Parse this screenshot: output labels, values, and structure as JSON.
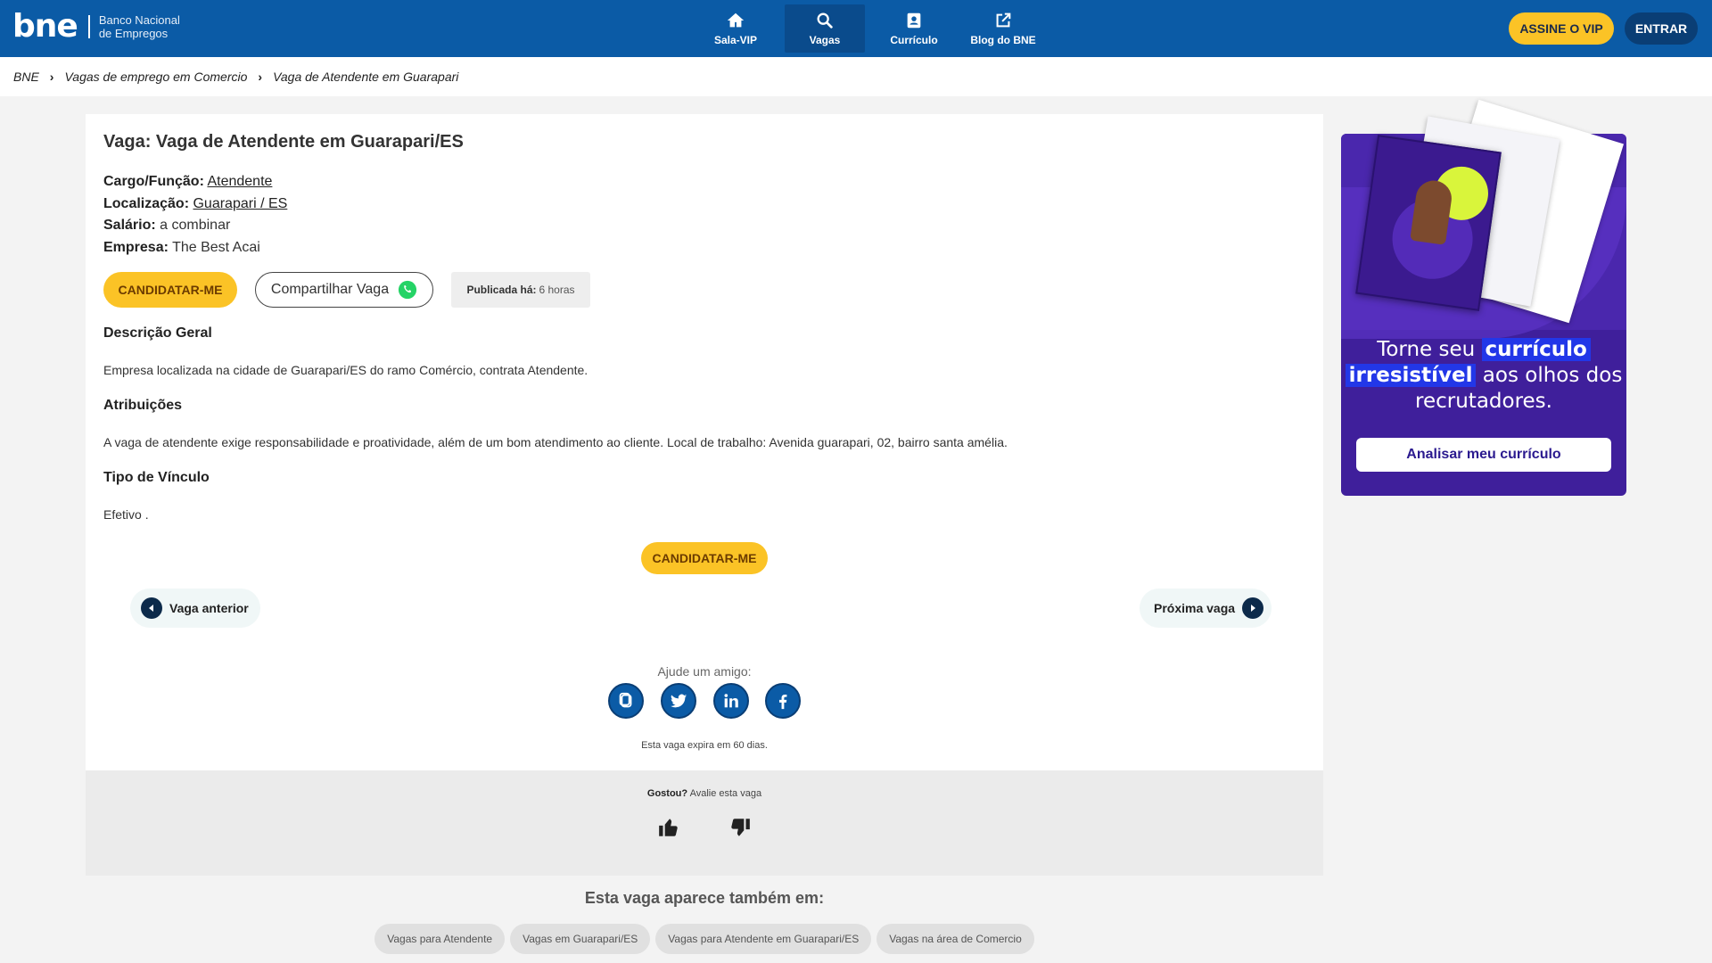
{
  "header": {
    "logo_mark": "bne",
    "logo_line1": "Banco Nacional",
    "logo_line2": "de Empregos",
    "nav": [
      {
        "label": "Sala-VIP",
        "icon": "home-icon"
      },
      {
        "label": "Vagas",
        "icon": "search-icon"
      },
      {
        "label": "Currículo",
        "icon": "resume-icon"
      },
      {
        "label": "Blog do BNE",
        "icon": "external-link-icon"
      }
    ],
    "vip_label": "ASSINE O VIP",
    "login_label": "ENTRAR",
    "colors": {
      "bar": "#0b5ba6",
      "accent": "#fbc326"
    }
  },
  "breadcrumb": [
    "BNE",
    "Vagas de emprego em Comercio",
    "Vaga de Atendente em Guarapari"
  ],
  "job": {
    "title": "Vaga: Vaga de Atendente em Guarapari/ES",
    "cargo_label": "Cargo/Função:",
    "cargo_value": "Atendente",
    "local_label": "Localização:",
    "local_value": "Guarapari / ES",
    "salario_label": "Salário:",
    "salario_value": "a combinar",
    "empresa_label": "Empresa:",
    "empresa_value": "The Best Acai",
    "apply_label": "CANDIDATAR-ME",
    "share_label": "Compartilhar Vaga",
    "published_label": "Publicada há:",
    "published_value": "6 horas",
    "sections": [
      {
        "heading": "Descrição Geral",
        "text": "Empresa localizada na cidade de Guarapari/ES do ramo Comércio, contrata Atendente."
      },
      {
        "heading": "Atribuições",
        "text": "A vaga de atendente exige responsabilidade e proatividade, além de um bom atendimento ao cliente. Local de trabalho: Avenida guarapari, 02, bairro santa amélia."
      },
      {
        "heading": "Tipo de Vínculo",
        "text": "Efetivo ."
      }
    ],
    "apply_bottom_label": "CANDIDATAR-ME",
    "prev_label": "Vaga anterior",
    "next_label": "Próxima vaga",
    "help_label": "Ajude um amigo:",
    "social": [
      "copy-icon",
      "twitter-icon",
      "linkedin-icon",
      "facebook-icon"
    ],
    "expire_text": "Esta vaga expira em 60 dias."
  },
  "rating": {
    "question_bold": "Gostou?",
    "question_rest": "Avalie esta vaga"
  },
  "also": {
    "title": "Esta vaga aparece também em:",
    "chips": [
      "Vagas para Atendente",
      "Vagas em Guarapari/ES",
      "Vagas para Atendente em Guarapari/ES",
      "Vagas na área de Comercio"
    ]
  },
  "promo": {
    "line1_pre": "Torne seu",
    "line1_hl": "currículo",
    "line2_hl": "irresistível",
    "line2_post": "aos olhos dos",
    "line3": "recrutadores.",
    "button": "Analisar meu currículo",
    "colors": {
      "bg": "#3f1f9b",
      "highlight": "#2237e8"
    }
  }
}
